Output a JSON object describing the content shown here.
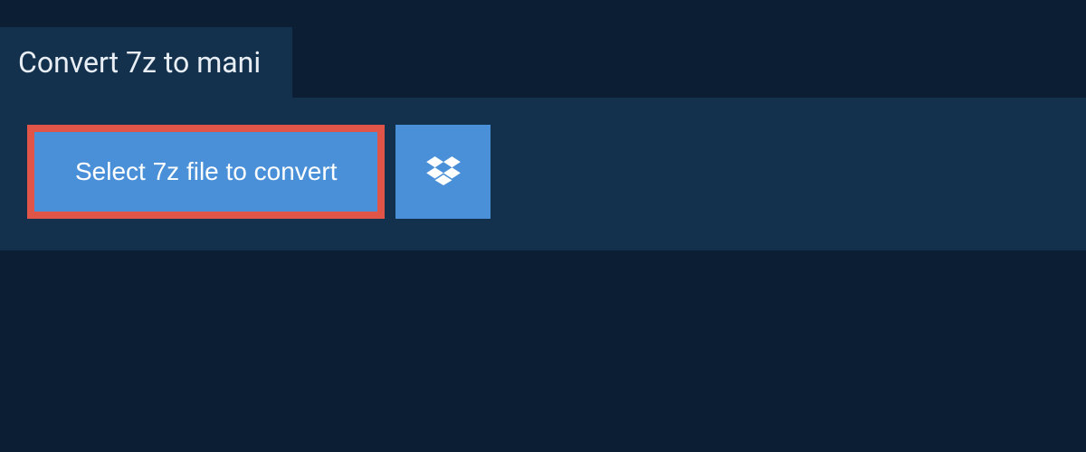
{
  "header": {
    "title": "Convert 7z to mani"
  },
  "upload": {
    "select_file_label": "Select 7z file to convert"
  }
}
